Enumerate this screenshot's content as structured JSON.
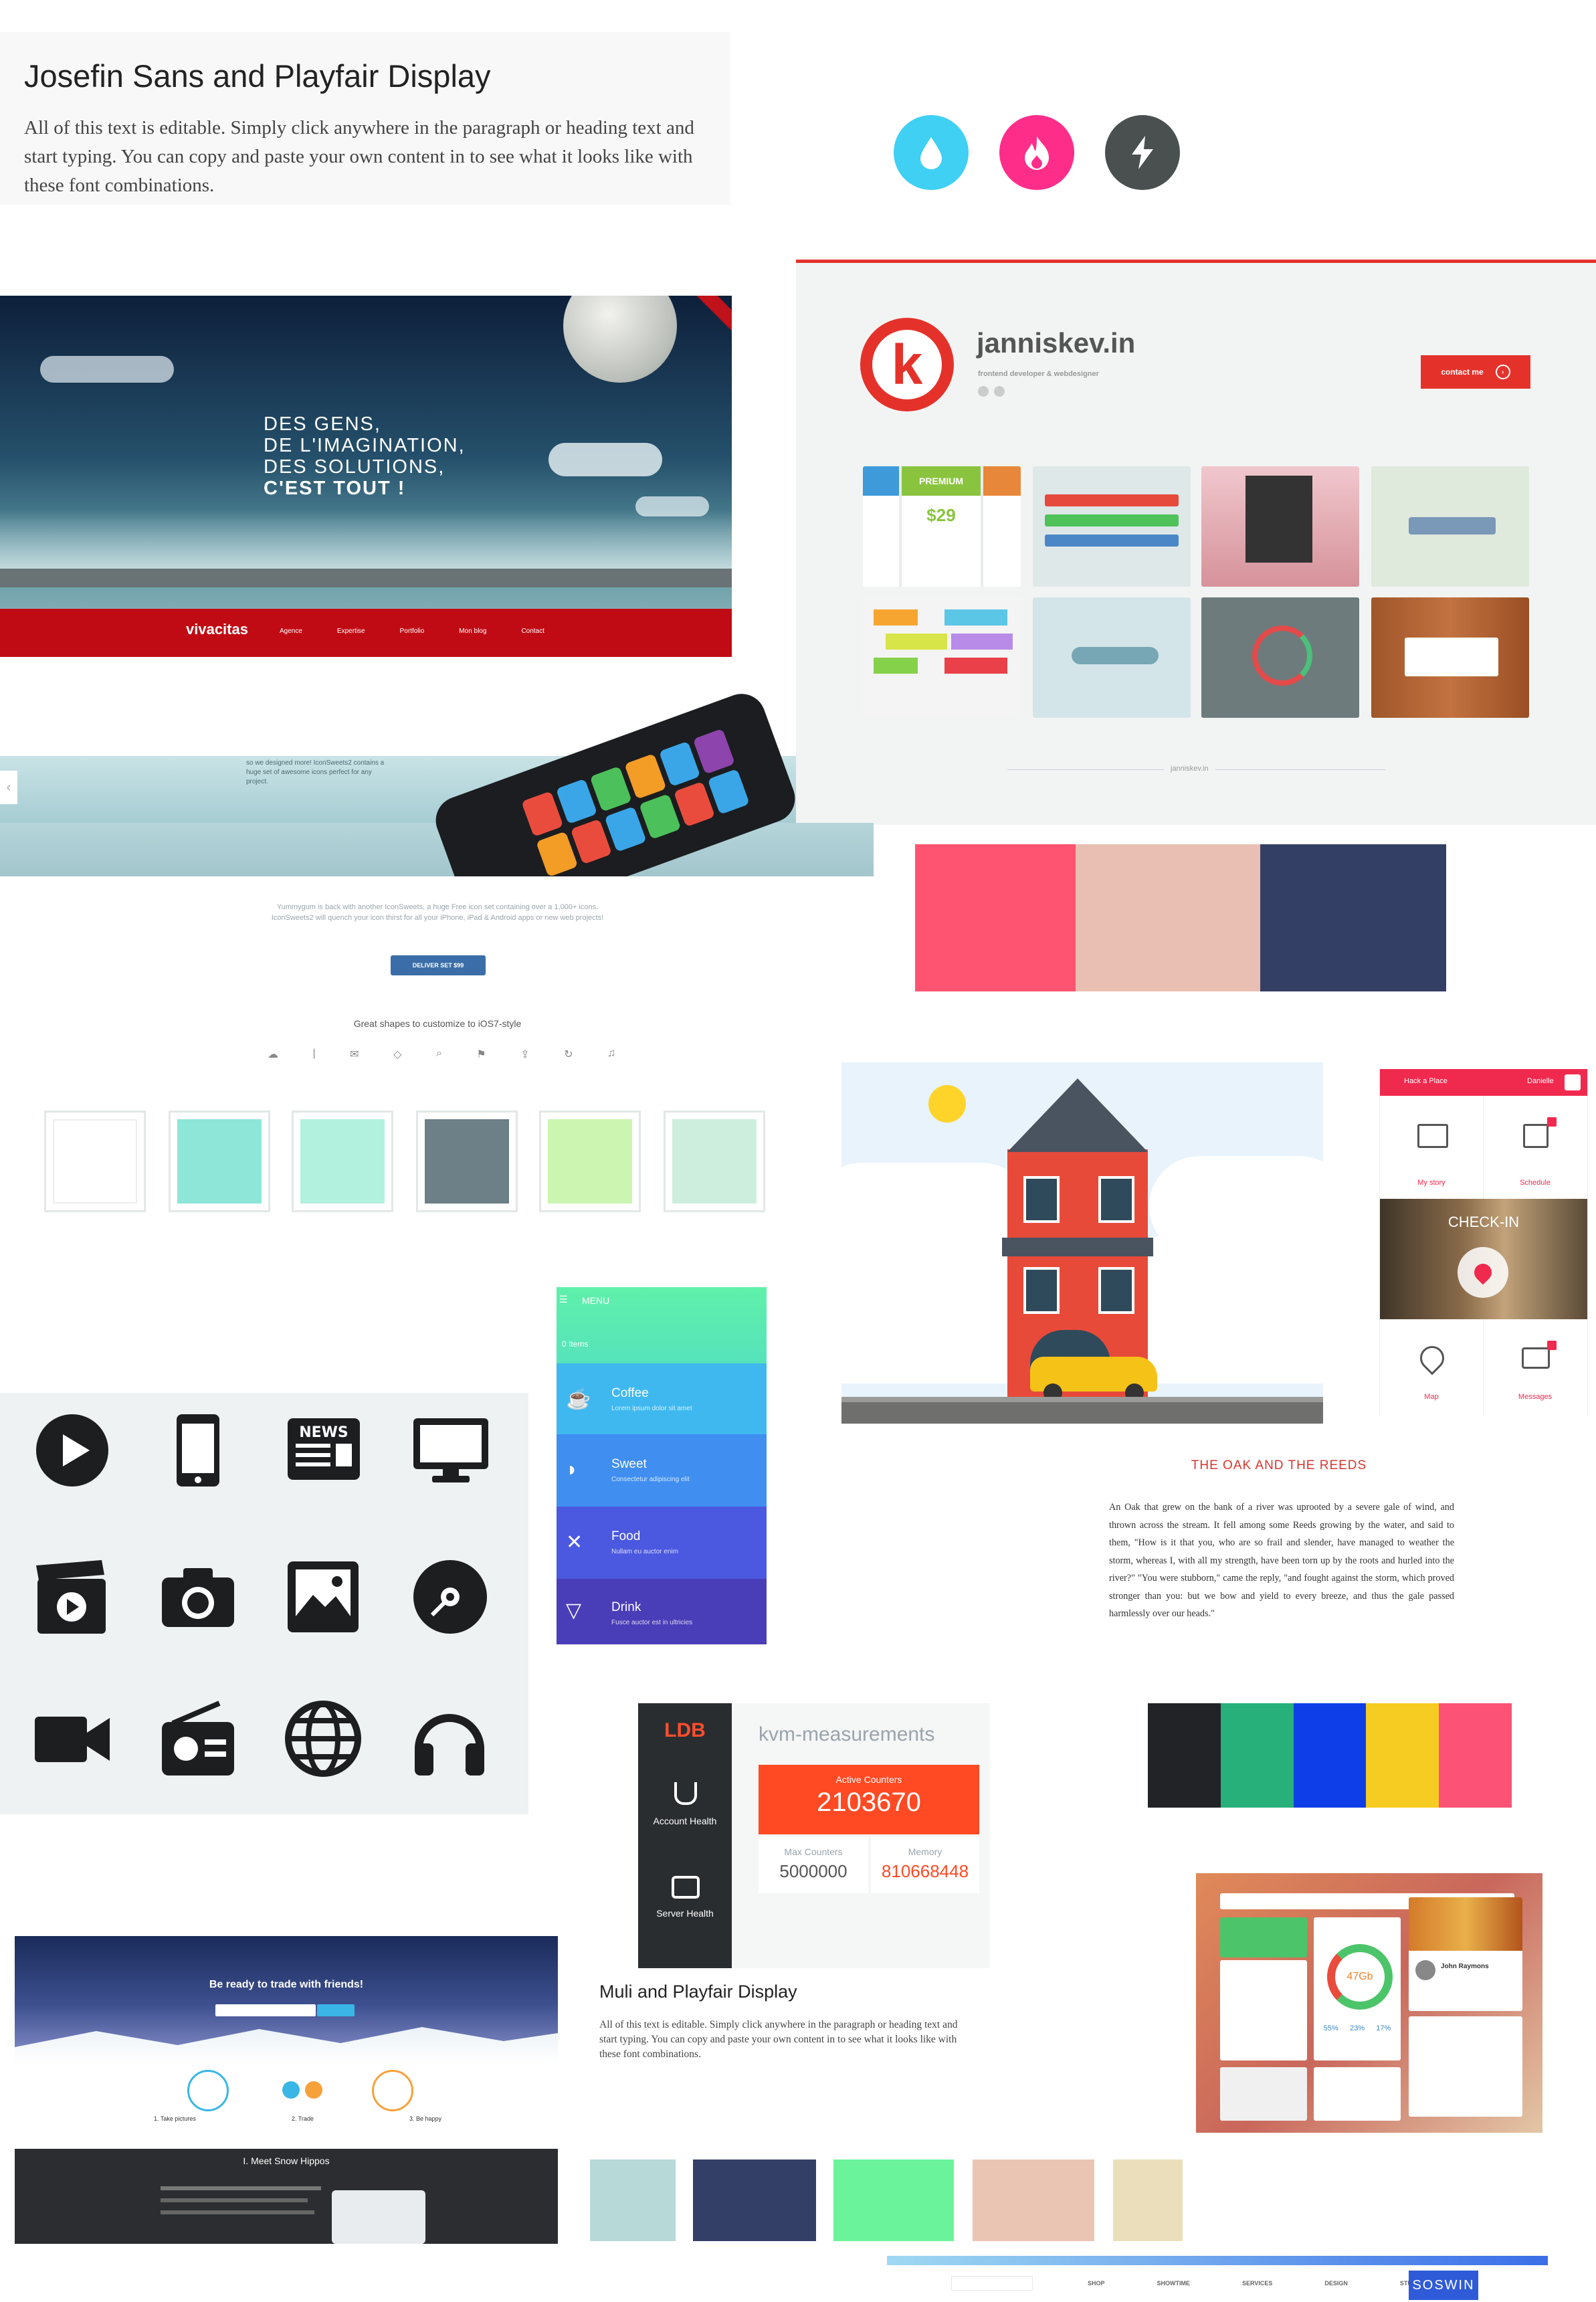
{
  "font_card_1": {
    "title": "Josefin Sans and Playfair Display",
    "body": "All of this text is editable. Simply click anywhere in the paragraph or heading text and start typing. You can copy and paste your own content in to see what it looks like with these font combinations."
  },
  "circle_icons": [
    {
      "name": "drop-icon",
      "color": "#3fd0f4"
    },
    {
      "name": "fire-icon",
      "color": "#ff2d8a"
    },
    {
      "name": "bolt-icon",
      "color": "#4a4f50"
    }
  ],
  "vivacitas": {
    "headline": [
      "DES GENS,",
      "DE L'IMAGINATION,",
      "DES SOLUTIONS,",
      "C'EST TOUT !"
    ],
    "logo": "vivacitas",
    "nav": [
      "Agence",
      "Expertise",
      "Portfolio",
      "Mon blog",
      "Contact"
    ]
  },
  "janniskev": {
    "logo_letter": "k",
    "title": "janniskev.in",
    "subtitle": "frontend developer & webdesigner",
    "contact_button": "contact me",
    "premium_label": "PREMIUM",
    "premium_price": "$29",
    "footer": "janniskev.in"
  },
  "iphone_page": {
    "top_text": "so we designed more! IconSweets2 contains a huge set of awesome icons perfect for any project.",
    "body": "Yummygum is back with another IconSweets, a huge Free icon set containing over a 1,000+ icons. IconSweets2 will quench your icon thirst for all your iPhone, iPad & Android apps or new web projects!",
    "button": "DELIVER SET $99",
    "shapes_title": "Great shapes to customize to iOS7-style"
  },
  "palette_1": [
    "#ff5471",
    "#e8bfb2",
    "#343f65"
  ],
  "square_swatches": [
    "#ffffff",
    "#8ee6d8",
    "#b2f1dd",
    "#6d7f87",
    "#cbf5b1",
    "#cdeedd"
  ],
  "city_illustration": {
    "sky": "#ffffff",
    "building": "#e84a3a",
    "taxi": "#f5c218"
  },
  "mobile_app": {
    "brand": "Hack a Place",
    "user": "Danielle",
    "tiles": [
      {
        "label": "My story",
        "icon": "book-icon"
      },
      {
        "label": "Schedule",
        "icon": "calendar-icon"
      },
      {
        "label": "Map",
        "icon": "map-icon"
      },
      {
        "label": "Messages",
        "icon": "messages-icon"
      }
    ],
    "checkin": "CHECK-IN"
  },
  "menu_app": {
    "menu_label": "MENU",
    "count": "0 Items",
    "items": [
      {
        "title": "Coffee",
        "subtitle": "Lorem ipsum dolor sit amet",
        "color": "#3fb8f0",
        "icon": "coffee-icon"
      },
      {
        "title": "Sweet",
        "subtitle": "Consectetur adipiscing elit",
        "color": "#3f8ef0",
        "icon": "croissant-icon"
      },
      {
        "title": "Food",
        "subtitle": "Nullam eu auctor enim",
        "color": "#4b58e0",
        "icon": "utensils-icon"
      },
      {
        "title": "Drink",
        "subtitle": "Fusce auctor est in ultricies",
        "color": "#4a3db8",
        "icon": "glass-icon"
      }
    ]
  },
  "glyph_grid": [
    "play-icon",
    "mobile-icon",
    "news-icon",
    "monitor-icon",
    "clapper-icon",
    "camera-icon",
    "image-icon",
    "disc-icon",
    "video-camera-icon",
    "radio-icon",
    "globe-icon",
    "headphones-icon"
  ],
  "news_label": "NEWS",
  "fable": {
    "title": "THE OAK AND THE REEDS",
    "body": "An Oak that grew on the bank of a river was uprooted by a severe gale of wind, and thrown across the stream. It fell among some Reeds growing by the water, and said to them, \"How is it that you, who are so frail and slender, have managed to weather the storm, whereas I, with all my strength, have been torn up by the roots and hurled into the river?\" \"You were stubborn,\" came the reply, \"and fought against the storm, which proved stronger than you: but we bow and yield to every breeze, and thus the gale passed harmlessly over our heads.\""
  },
  "dashboard": {
    "logo": "LDB",
    "title": "kvm-measurements",
    "nav": [
      {
        "label": "Account Health",
        "icon": "stethoscope-icon"
      },
      {
        "label": "Server Health",
        "icon": "hard-drive-icon"
      }
    ],
    "active_label": "Active Counters",
    "active_value": "2103670",
    "max_label": "Max Counters",
    "max_value": "5000000",
    "memory_label": "Memory",
    "memory_value": "810668448"
  },
  "palette_2": [
    "#222326",
    "#27b07a",
    "#0e3ee8",
    "#f7cc22",
    "#fb5276"
  ],
  "trade_page": {
    "headline": "Be ready to trade with friends!",
    "steps": [
      "1. Take pictures",
      "2. Trade",
      "3. Be happy"
    ],
    "section_title": "I. Meet Snow Hippos"
  },
  "font_card_2": {
    "title": "Muli and Playfair Display",
    "body": "All of this text is editable. Simply click anywhere in the paragraph or heading text and start typing. You can copy and paste your own content in to see what it looks like with these font combinations."
  },
  "palette_3": [
    "#b7d9d8",
    "#333f66",
    "#6bf39b",
    "#ebc5b4",
    "#ebdfbb"
  ],
  "ui_kit": {
    "storage_value": "47Gb",
    "user_name": "John Raymons",
    "percents": [
      "55%",
      "23%",
      "17%"
    ]
  },
  "bottom_bar": {
    "logo": "SOSWIN",
    "nav": [
      "SHOP",
      "SHOWTIME",
      "SERVICES",
      "DESIGN",
      "STUDIO"
    ]
  }
}
